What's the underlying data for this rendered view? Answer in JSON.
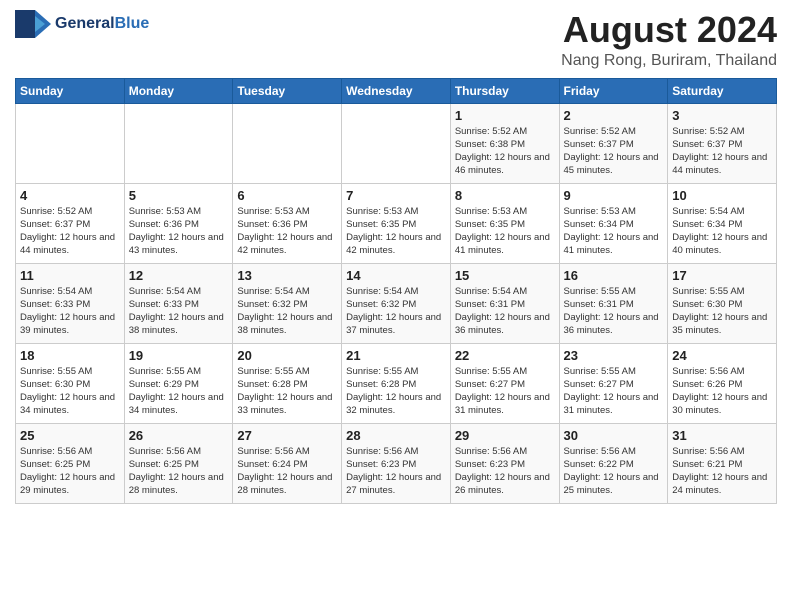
{
  "header": {
    "logo_line1": "General",
    "logo_line2": "Blue",
    "month_title": "August 2024",
    "location": "Nang Rong, Buriram, Thailand"
  },
  "days_of_week": [
    "Sunday",
    "Monday",
    "Tuesday",
    "Wednesday",
    "Thursday",
    "Friday",
    "Saturday"
  ],
  "weeks": [
    [
      {
        "date": "",
        "sunrise": "",
        "sunset": "",
        "daylight": ""
      },
      {
        "date": "",
        "sunrise": "",
        "sunset": "",
        "daylight": ""
      },
      {
        "date": "",
        "sunrise": "",
        "sunset": "",
        "daylight": ""
      },
      {
        "date": "",
        "sunrise": "",
        "sunset": "",
        "daylight": ""
      },
      {
        "date": "1",
        "sunrise": "Sunrise: 5:52 AM",
        "sunset": "Sunset: 6:38 PM",
        "daylight": "Daylight: 12 hours and 46 minutes."
      },
      {
        "date": "2",
        "sunrise": "Sunrise: 5:52 AM",
        "sunset": "Sunset: 6:37 PM",
        "daylight": "Daylight: 12 hours and 45 minutes."
      },
      {
        "date": "3",
        "sunrise": "Sunrise: 5:52 AM",
        "sunset": "Sunset: 6:37 PM",
        "daylight": "Daylight: 12 hours and 44 minutes."
      }
    ],
    [
      {
        "date": "4",
        "sunrise": "Sunrise: 5:52 AM",
        "sunset": "Sunset: 6:37 PM",
        "daylight": "Daylight: 12 hours and 44 minutes."
      },
      {
        "date": "5",
        "sunrise": "Sunrise: 5:53 AM",
        "sunset": "Sunset: 6:36 PM",
        "daylight": "Daylight: 12 hours and 43 minutes."
      },
      {
        "date": "6",
        "sunrise": "Sunrise: 5:53 AM",
        "sunset": "Sunset: 6:36 PM",
        "daylight": "Daylight: 12 hours and 42 minutes."
      },
      {
        "date": "7",
        "sunrise": "Sunrise: 5:53 AM",
        "sunset": "Sunset: 6:35 PM",
        "daylight": "Daylight: 12 hours and 42 minutes."
      },
      {
        "date": "8",
        "sunrise": "Sunrise: 5:53 AM",
        "sunset": "Sunset: 6:35 PM",
        "daylight": "Daylight: 12 hours and 41 minutes."
      },
      {
        "date": "9",
        "sunrise": "Sunrise: 5:53 AM",
        "sunset": "Sunset: 6:34 PM",
        "daylight": "Daylight: 12 hours and 41 minutes."
      },
      {
        "date": "10",
        "sunrise": "Sunrise: 5:54 AM",
        "sunset": "Sunset: 6:34 PM",
        "daylight": "Daylight: 12 hours and 40 minutes."
      }
    ],
    [
      {
        "date": "11",
        "sunrise": "Sunrise: 5:54 AM",
        "sunset": "Sunset: 6:33 PM",
        "daylight": "Daylight: 12 hours and 39 minutes."
      },
      {
        "date": "12",
        "sunrise": "Sunrise: 5:54 AM",
        "sunset": "Sunset: 6:33 PM",
        "daylight": "Daylight: 12 hours and 38 minutes."
      },
      {
        "date": "13",
        "sunrise": "Sunrise: 5:54 AM",
        "sunset": "Sunset: 6:32 PM",
        "daylight": "Daylight: 12 hours and 38 minutes."
      },
      {
        "date": "14",
        "sunrise": "Sunrise: 5:54 AM",
        "sunset": "Sunset: 6:32 PM",
        "daylight": "Daylight: 12 hours and 37 minutes."
      },
      {
        "date": "15",
        "sunrise": "Sunrise: 5:54 AM",
        "sunset": "Sunset: 6:31 PM",
        "daylight": "Daylight: 12 hours and 36 minutes."
      },
      {
        "date": "16",
        "sunrise": "Sunrise: 5:55 AM",
        "sunset": "Sunset: 6:31 PM",
        "daylight": "Daylight: 12 hours and 36 minutes."
      },
      {
        "date": "17",
        "sunrise": "Sunrise: 5:55 AM",
        "sunset": "Sunset: 6:30 PM",
        "daylight": "Daylight: 12 hours and 35 minutes."
      }
    ],
    [
      {
        "date": "18",
        "sunrise": "Sunrise: 5:55 AM",
        "sunset": "Sunset: 6:30 PM",
        "daylight": "Daylight: 12 hours and 34 minutes."
      },
      {
        "date": "19",
        "sunrise": "Sunrise: 5:55 AM",
        "sunset": "Sunset: 6:29 PM",
        "daylight": "Daylight: 12 hours and 34 minutes."
      },
      {
        "date": "20",
        "sunrise": "Sunrise: 5:55 AM",
        "sunset": "Sunset: 6:28 PM",
        "daylight": "Daylight: 12 hours and 33 minutes."
      },
      {
        "date": "21",
        "sunrise": "Sunrise: 5:55 AM",
        "sunset": "Sunset: 6:28 PM",
        "daylight": "Daylight: 12 hours and 32 minutes."
      },
      {
        "date": "22",
        "sunrise": "Sunrise: 5:55 AM",
        "sunset": "Sunset: 6:27 PM",
        "daylight": "Daylight: 12 hours and 31 minutes."
      },
      {
        "date": "23",
        "sunrise": "Sunrise: 5:55 AM",
        "sunset": "Sunset: 6:27 PM",
        "daylight": "Daylight: 12 hours and 31 minutes."
      },
      {
        "date": "24",
        "sunrise": "Sunrise: 5:56 AM",
        "sunset": "Sunset: 6:26 PM",
        "daylight": "Daylight: 12 hours and 30 minutes."
      }
    ],
    [
      {
        "date": "25",
        "sunrise": "Sunrise: 5:56 AM",
        "sunset": "Sunset: 6:25 PM",
        "daylight": "Daylight: 12 hours and 29 minutes."
      },
      {
        "date": "26",
        "sunrise": "Sunrise: 5:56 AM",
        "sunset": "Sunset: 6:25 PM",
        "daylight": "Daylight: 12 hours and 28 minutes."
      },
      {
        "date": "27",
        "sunrise": "Sunrise: 5:56 AM",
        "sunset": "Sunset: 6:24 PM",
        "daylight": "Daylight: 12 hours and 28 minutes."
      },
      {
        "date": "28",
        "sunrise": "Sunrise: 5:56 AM",
        "sunset": "Sunset: 6:23 PM",
        "daylight": "Daylight: 12 hours and 27 minutes."
      },
      {
        "date": "29",
        "sunrise": "Sunrise: 5:56 AM",
        "sunset": "Sunset: 6:23 PM",
        "daylight": "Daylight: 12 hours and 26 minutes."
      },
      {
        "date": "30",
        "sunrise": "Sunrise: 5:56 AM",
        "sunset": "Sunset: 6:22 PM",
        "daylight": "Daylight: 12 hours and 25 minutes."
      },
      {
        "date": "31",
        "sunrise": "Sunrise: 5:56 AM",
        "sunset": "Sunset: 6:21 PM",
        "daylight": "Daylight: 12 hours and 24 minutes."
      }
    ]
  ]
}
